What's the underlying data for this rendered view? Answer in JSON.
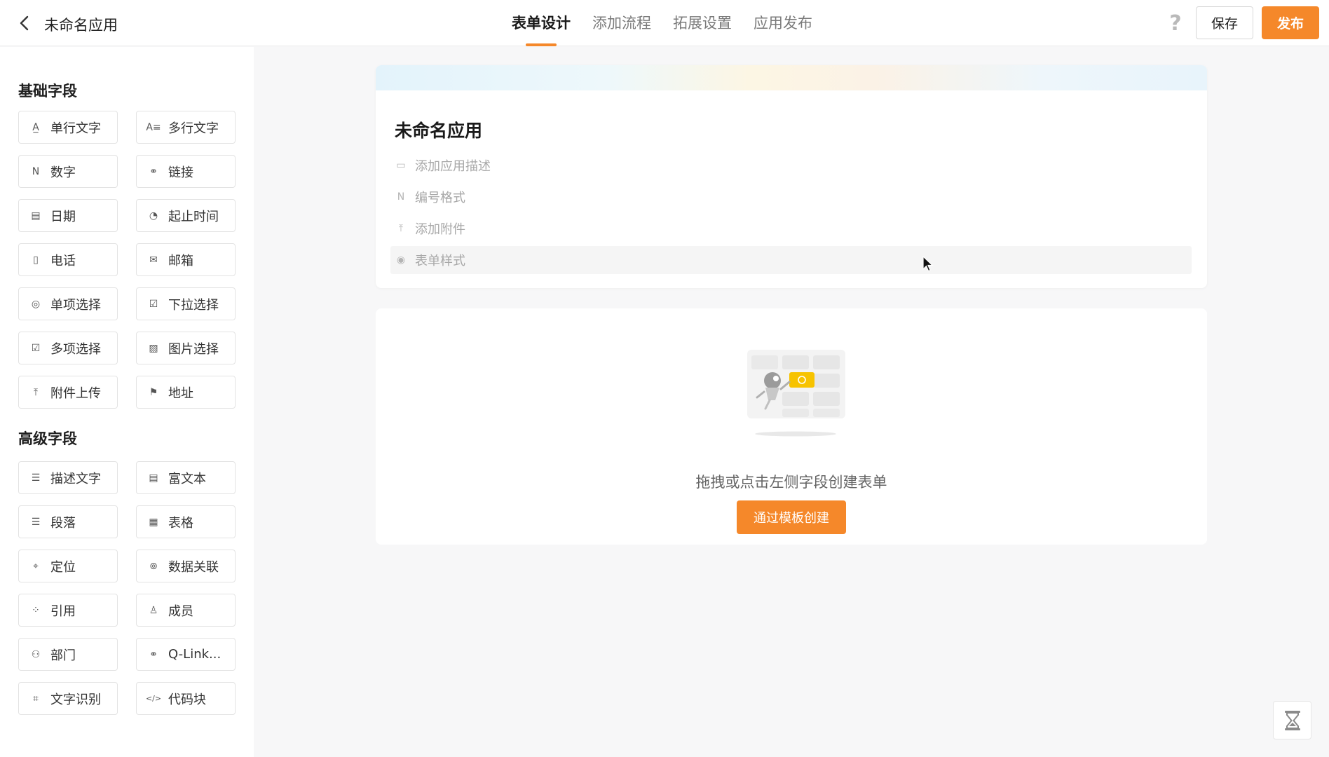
{
  "header": {
    "app_title": "未命名应用",
    "tabs": [
      {
        "label": "表单设计",
        "active": true
      },
      {
        "label": "添加流程",
        "active": false
      },
      {
        "label": "拓展设置",
        "active": false
      },
      {
        "label": "应用发布",
        "active": false
      }
    ],
    "help_icon": "?",
    "save_label": "保存",
    "publish_label": "发布"
  },
  "sidebar": {
    "basic_title": "基础字段",
    "basic_fields": [
      {
        "label": "单行文字",
        "icon": "A̲"
      },
      {
        "label": "多行文字",
        "icon": "A≡"
      },
      {
        "label": "数字",
        "icon": "N"
      },
      {
        "label": "链接",
        "icon": "⚭"
      },
      {
        "label": "日期",
        "icon": "▤"
      },
      {
        "label": "起止时间",
        "icon": "◔"
      },
      {
        "label": "电话",
        "icon": "▯"
      },
      {
        "label": "邮箱",
        "icon": "✉"
      },
      {
        "label": "单项选择",
        "icon": "◎"
      },
      {
        "label": "下拉选择",
        "icon": "☑"
      },
      {
        "label": "多项选择",
        "icon": "☑"
      },
      {
        "label": "图片选择",
        "icon": "▨"
      },
      {
        "label": "附件上传",
        "icon": "⤒"
      },
      {
        "label": "地址",
        "icon": "⚑"
      }
    ],
    "advanced_title": "高级字段",
    "advanced_fields": [
      {
        "label": "描述文字",
        "icon": "☰"
      },
      {
        "label": "富文本",
        "icon": "▤"
      },
      {
        "label": "段落",
        "icon": "☰"
      },
      {
        "label": "表格",
        "icon": "▦"
      },
      {
        "label": "定位",
        "icon": "⌖"
      },
      {
        "label": "数据关联",
        "icon": "⊚"
      },
      {
        "label": "引用",
        "icon": "⁘"
      },
      {
        "label": "成员",
        "icon": "♙"
      },
      {
        "label": "部门",
        "icon": "⚇"
      },
      {
        "label": "Q-Link...",
        "icon": "⚭"
      },
      {
        "label": "文字识别",
        "icon": "⌗"
      },
      {
        "label": "代码块",
        "icon": "</>"
      }
    ]
  },
  "form": {
    "title": "未命名应用",
    "meta": [
      {
        "label": "添加应用描述",
        "icon": "▭"
      },
      {
        "label": "编号格式",
        "icon": "N"
      },
      {
        "label": "添加附件",
        "icon": "⤒"
      },
      {
        "label": "表单样式",
        "icon": "◉"
      }
    ]
  },
  "empty": {
    "hint": "拖拽或点击左侧字段创建表单",
    "template_button": "通过模板创建"
  },
  "colors": {
    "accent": "#f5882a"
  }
}
